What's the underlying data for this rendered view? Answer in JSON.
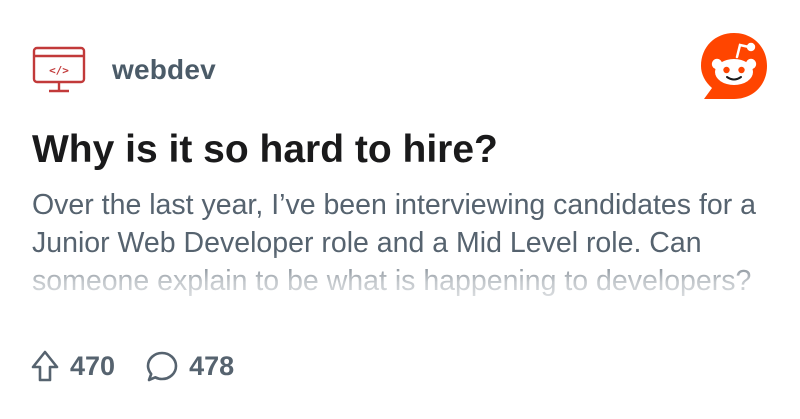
{
  "post": {
    "subreddit": "webdev",
    "subreddit_icon": "code-monitor-icon",
    "title": "Why is it so hard to hire?",
    "body": "Over the last year, I’ve been interviewing candidates for a Junior Web Developer role and a Mid Level role. Can someone explain to be what is happening to developers?",
    "upvotes": "470",
    "comments": "478"
  },
  "icons": {
    "logo": "reddit-logo-icon",
    "upvote": "upvote-arrow-icon",
    "comments": "comment-bubble-icon"
  },
  "colors": {
    "accent": "#ff4500",
    "icon_red": "#c23a3a",
    "title": "#1a1a1b",
    "text": "#56636f"
  }
}
